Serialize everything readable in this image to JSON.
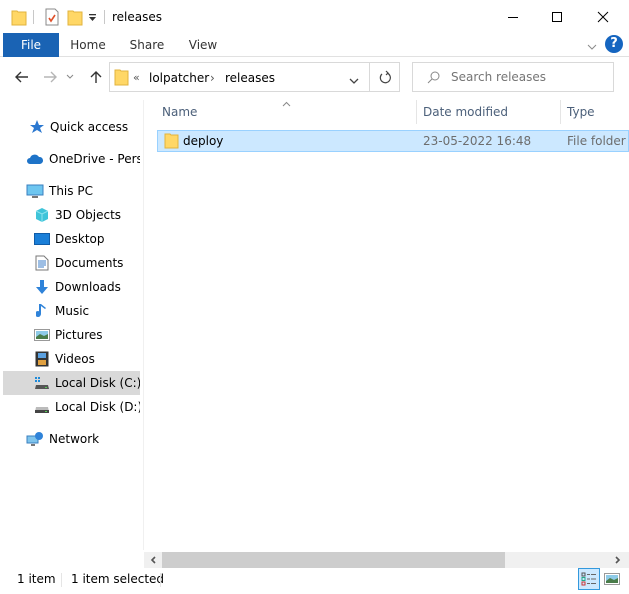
{
  "window": {
    "title": "releases",
    "controls": {
      "minimize": "minimize",
      "maximize": "maximize",
      "close": "close"
    }
  },
  "quick_access_toolbar": {
    "icons": [
      "folder-icon",
      "properties-icon",
      "new-folder-icon",
      "customize-dropdown-icon"
    ]
  },
  "ribbon": {
    "tabs": [
      {
        "label": "File",
        "active": true
      },
      {
        "label": "Home"
      },
      {
        "label": "Share"
      },
      {
        "label": "View"
      }
    ],
    "help_label": "?"
  },
  "address": {
    "overflow": "«",
    "breadcrumbs": [
      "lolpatcher",
      "releases"
    ],
    "separator": "›"
  },
  "search": {
    "placeholder": "Search releases"
  },
  "sidebar": {
    "items": [
      {
        "label": "Quick access",
        "icon": "quick-access-star-icon"
      },
      {
        "label": "OneDrive - Personal",
        "icon": "onedrive-cloud-icon"
      },
      {
        "label": "This PC",
        "icon": "this-pc-icon"
      },
      {
        "label": "3D Objects",
        "icon": "3d-objects-icon"
      },
      {
        "label": "Desktop",
        "icon": "desktop-icon"
      },
      {
        "label": "Documents",
        "icon": "documents-icon"
      },
      {
        "label": "Downloads",
        "icon": "downloads-icon"
      },
      {
        "label": "Music",
        "icon": "music-icon"
      },
      {
        "label": "Pictures",
        "icon": "pictures-icon"
      },
      {
        "label": "Videos",
        "icon": "videos-icon"
      },
      {
        "label": "Local Disk (C:)",
        "icon": "local-disk-c-icon",
        "selected": true
      },
      {
        "label": "Local Disk (D:)",
        "icon": "local-disk-d-icon"
      },
      {
        "label": "Network",
        "icon": "network-icon"
      }
    ]
  },
  "file_list": {
    "columns": [
      "Name",
      "Date modified",
      "Type"
    ],
    "sort_column": "Name",
    "sort_direction": "ascending",
    "rows": [
      {
        "name": "deploy",
        "date_modified": "23-05-2022 16:48",
        "type": "File folder",
        "selected": true
      }
    ]
  },
  "status_bar": {
    "item_count": "1 item",
    "selection": "1 item selected"
  },
  "colors": {
    "accent": "#1a63b4",
    "selection_bg": "#cce8ff",
    "selection_border": "#99d1ff",
    "folder_yellow": "#ffd766"
  }
}
